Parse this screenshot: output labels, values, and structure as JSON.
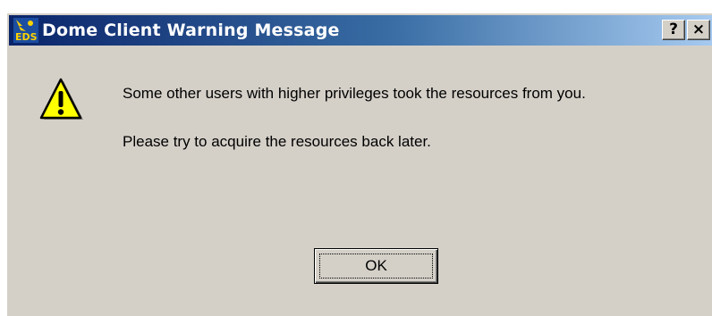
{
  "window": {
    "title": "Dome Client Warning Message",
    "app_icon": "eds-app-icon",
    "title_buttons": {
      "help_label": "?",
      "close_label": "×"
    }
  },
  "dialog": {
    "icon": "warning-icon",
    "messages": [
      "Some other users with higher privileges took the resources from you.",
      "Please try to acquire the resources back later."
    ],
    "ok_label": "OK"
  },
  "colors": {
    "face": "#d4d0c8",
    "title_gradient_start": "#0a246a",
    "title_gradient_end": "#a6caf0",
    "warning_yellow": "#ffff00"
  }
}
